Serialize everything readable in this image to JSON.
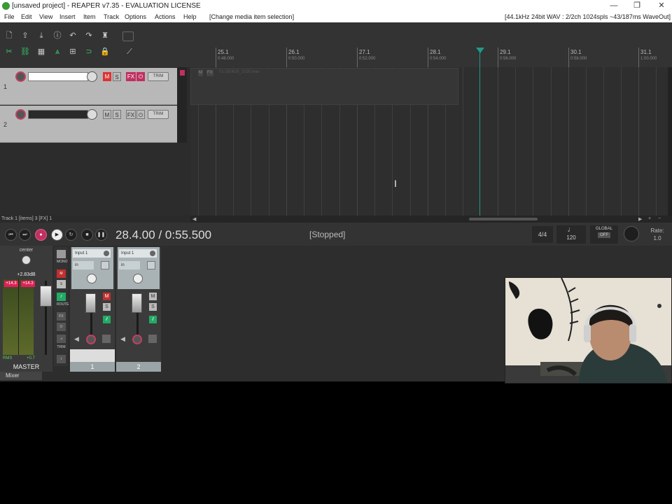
{
  "window": {
    "title": "[unsaved project] - REAPER v7.35 - EVALUATION LICENSE",
    "minimize": "—",
    "maximize": "❐",
    "close": "✕"
  },
  "menu": {
    "items": [
      "File",
      "Edit",
      "View",
      "Insert",
      "Item",
      "Track",
      "Options",
      "Actions",
      "Help"
    ],
    "action_status": "[Change media item selection]",
    "audio_status": "[44.1kHz 24bit WAV : 2/2ch 1024spls ~43/187ms WaveOut]"
  },
  "ruler": {
    "labels": [
      "25.1",
      "26.1",
      "27.1",
      "28.1",
      "29.1",
      "30.1",
      "31.1"
    ],
    "times": [
      "0:48.000",
      "0:50.000",
      "0:52.000",
      "0:54.000",
      "0:56.000",
      "0:58.000",
      "1:00.000"
    ]
  },
  "tracks": [
    {
      "number": "1",
      "fx": "FX",
      "m": "M",
      "s": "S",
      "trim": "TRIM"
    },
    {
      "number": "2",
      "fx": "FX",
      "m": "M",
      "s": "S",
      "trim": "TRIM"
    }
  ],
  "item": {
    "name": "01-250626_1020.wav",
    "m": "M",
    "fx": "FX"
  },
  "status_line": "Track 1 [items] 3 [FX] 1",
  "transport": {
    "time": "28.4.00 / 0:55.500",
    "state": "[Stopped]",
    "time_signature": "4/4",
    "bpm": "120",
    "global_label": "GLOBAL",
    "global_state": "OFF",
    "rate_label": "Rate:",
    "rate_value": "1.0"
  },
  "master": {
    "pan": "center",
    "peak": "+2.83dB",
    "clipL": "+14.3",
    "clipR": "+14.3",
    "rms_label": "RMS",
    "rms_value": "+0.7",
    "label": "MASTER",
    "side_labels": {
      "mono": "MONO",
      "m": "M",
      "s": "S",
      "route": "ROUTE",
      "fx": "FX",
      "trim": "TRIM",
      "info": "i"
    }
  },
  "strips": [
    {
      "input": "Input 1",
      "in": "in",
      "m": "M",
      "s": "S",
      "number": "1"
    },
    {
      "input": "Input 1",
      "in": "in",
      "m": "M",
      "s": "S",
      "number": "2"
    }
  ],
  "mixer_tab": "Mixer",
  "colors": {
    "accent": "#c03060",
    "cursor": "#1f9b8a",
    "mute": "#d33333"
  }
}
